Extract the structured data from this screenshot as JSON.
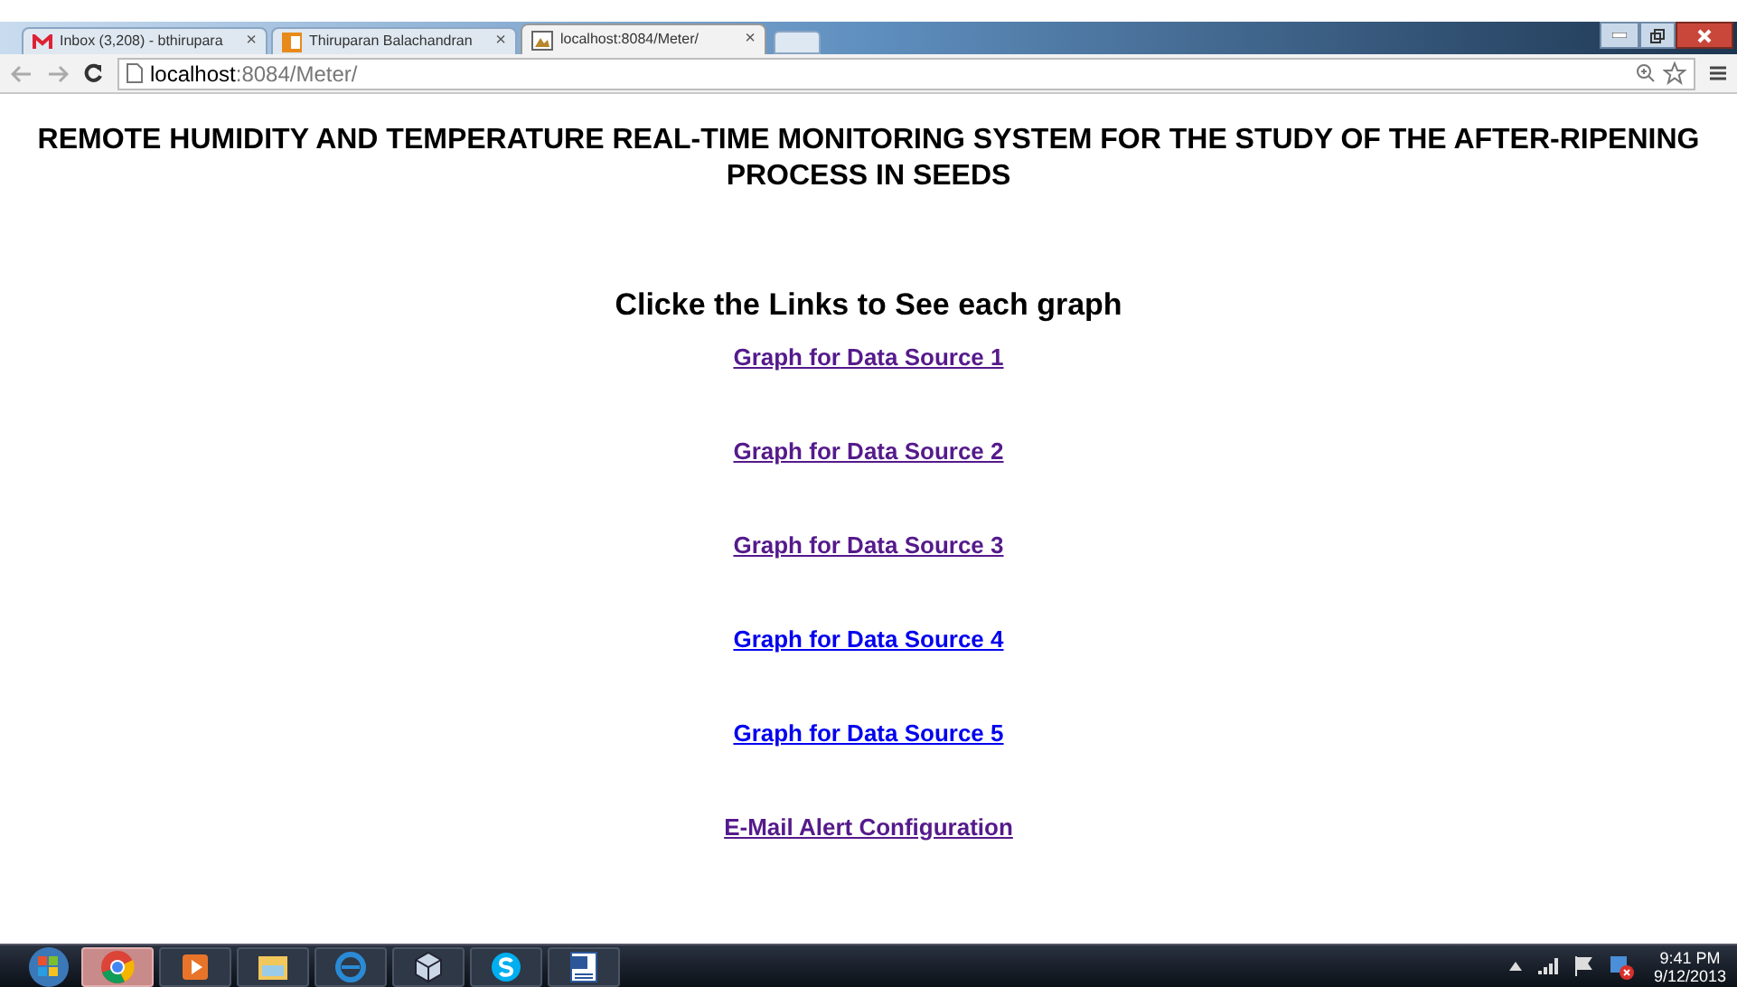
{
  "browser": {
    "tabs": [
      {
        "title": "Inbox (3,208) - bthirupara",
        "close": "×",
        "selected": false,
        "kind": "mail"
      },
      {
        "title": "Thiruparan Balachandran",
        "close": "×",
        "selected": false,
        "kind": "office"
      },
      {
        "title": "localhost:8084/Meter/",
        "close": "×",
        "selected": true,
        "kind": "page"
      }
    ],
    "address": {
      "host": "localhost",
      "rest": ":8084/Meter/"
    }
  },
  "page": {
    "heading": "REMOTE HUMIDITY AND TEMPERATURE REAL-TIME MONITORING SYSTEM FOR THE STUDY OF THE AFTER-RIPENING PROCESS IN SEEDS",
    "subheading": "Clicke the Links to See each graph",
    "links": [
      {
        "label": "Graph for Data Source 1",
        "visited": true
      },
      {
        "label": "Graph for Data Source 2",
        "visited": true
      },
      {
        "label": "Graph for Data Source 3",
        "visited": true
      },
      {
        "label": "Graph for Data Source 4",
        "visited": false
      },
      {
        "label": "Graph for Data Source 5",
        "visited": false
      },
      {
        "label": "E-Mail Alert Configuration",
        "visited": true
      }
    ]
  },
  "taskbar": {
    "apps": [
      {
        "kind": "chrome",
        "selected": true
      },
      {
        "kind": "media",
        "selected": false
      },
      {
        "kind": "folder",
        "selected": false
      },
      {
        "kind": "ie",
        "selected": false
      },
      {
        "kind": "cube",
        "selected": false
      },
      {
        "kind": "skype",
        "selected": false
      },
      {
        "kind": "word",
        "selected": false
      }
    ],
    "time": "9:41 PM",
    "date": "9/12/2013"
  }
}
